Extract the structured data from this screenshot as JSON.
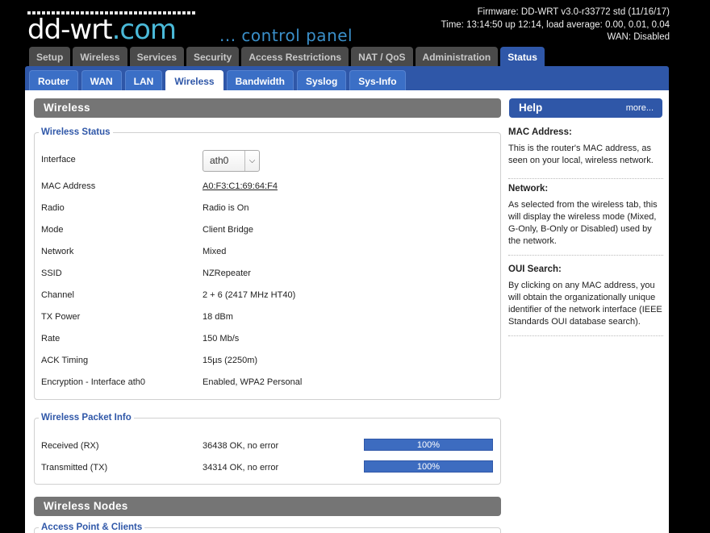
{
  "header": {
    "logo_text": "dd-wrt",
    "logo_tld": ".com",
    "tagline": "... control panel",
    "firmware": "Firmware: DD-WRT v3.0-r33772 std (11/16/17)",
    "time": "Time: 13:14:50 up 12:14, load average: 0.00, 0.01, 0.04",
    "wan": "WAN: Disabled"
  },
  "tabs": [
    {
      "label": "Setup",
      "active": false
    },
    {
      "label": "Wireless",
      "active": false
    },
    {
      "label": "Services",
      "active": false
    },
    {
      "label": "Security",
      "active": false
    },
    {
      "label": "Access Restrictions",
      "active": false
    },
    {
      "label": "NAT / QoS",
      "active": false
    },
    {
      "label": "Administration",
      "active": false
    },
    {
      "label": "Status",
      "active": true
    }
  ],
  "subtabs": [
    {
      "label": "Router",
      "active": false
    },
    {
      "label": "WAN",
      "active": false
    },
    {
      "label": "LAN",
      "active": false
    },
    {
      "label": "Wireless",
      "active": true
    },
    {
      "label": "Bandwidth",
      "active": false
    },
    {
      "label": "Syslog",
      "active": false
    },
    {
      "label": "Sys-Info",
      "active": false
    }
  ],
  "main": {
    "section_title": "Wireless",
    "status": {
      "legend": "Wireless Status",
      "interface_label": "Interface",
      "interface_value": "ath0",
      "rows": [
        {
          "label": "MAC Address",
          "value": "A0:F3:C1:69:64:F4"
        },
        {
          "label": "Radio",
          "value": "Radio is On"
        },
        {
          "label": "Mode",
          "value": "Client Bridge"
        },
        {
          "label": "Network",
          "value": "Mixed"
        },
        {
          "label": "SSID",
          "value": "NZRepeater"
        },
        {
          "label": "Channel",
          "value": "2 + 6 (2417 MHz HT40)"
        },
        {
          "label": "TX Power",
          "value": "18 dBm"
        },
        {
          "label": "Rate",
          "value": "150 Mb/s"
        },
        {
          "label": "ACK Timing",
          "value": "15µs (2250m)"
        },
        {
          "label": "Encryption - Interface ath0",
          "value": "Enabled, WPA2 Personal"
        }
      ]
    },
    "packet": {
      "legend": "Wireless Packet Info",
      "rows": [
        {
          "label": "Received (RX)",
          "value": "36438 OK, no error",
          "percent_label": "100%",
          "percent": 100
        },
        {
          "label": "Transmitted (TX)",
          "value": "34314 OK, no error",
          "percent_label": "100%",
          "percent": 100
        }
      ]
    },
    "nodes_title": "Wireless Nodes",
    "nodes_legend": "Access Point & Clients"
  },
  "help": {
    "title": "Help",
    "more": "more...",
    "items": [
      {
        "title": "MAC Address:",
        "text": "This is the router's MAC address, as seen on your local, wireless network."
      },
      {
        "title": "Network:",
        "text": "As selected from the wireless tab, this will display the wireless mode (Mixed, G-Only, B-Only or Disabled) used by the network."
      },
      {
        "title": "OUI Search:",
        "text": "By clicking on any MAC address, you will obtain the organizationally unique identifier of the network interface (IEEE Standards OUI database search)."
      }
    ]
  },
  "colors": {
    "accent": "#2f57a8",
    "section_bar": "#757575",
    "tab_inactive": "#4a4a4a"
  }
}
